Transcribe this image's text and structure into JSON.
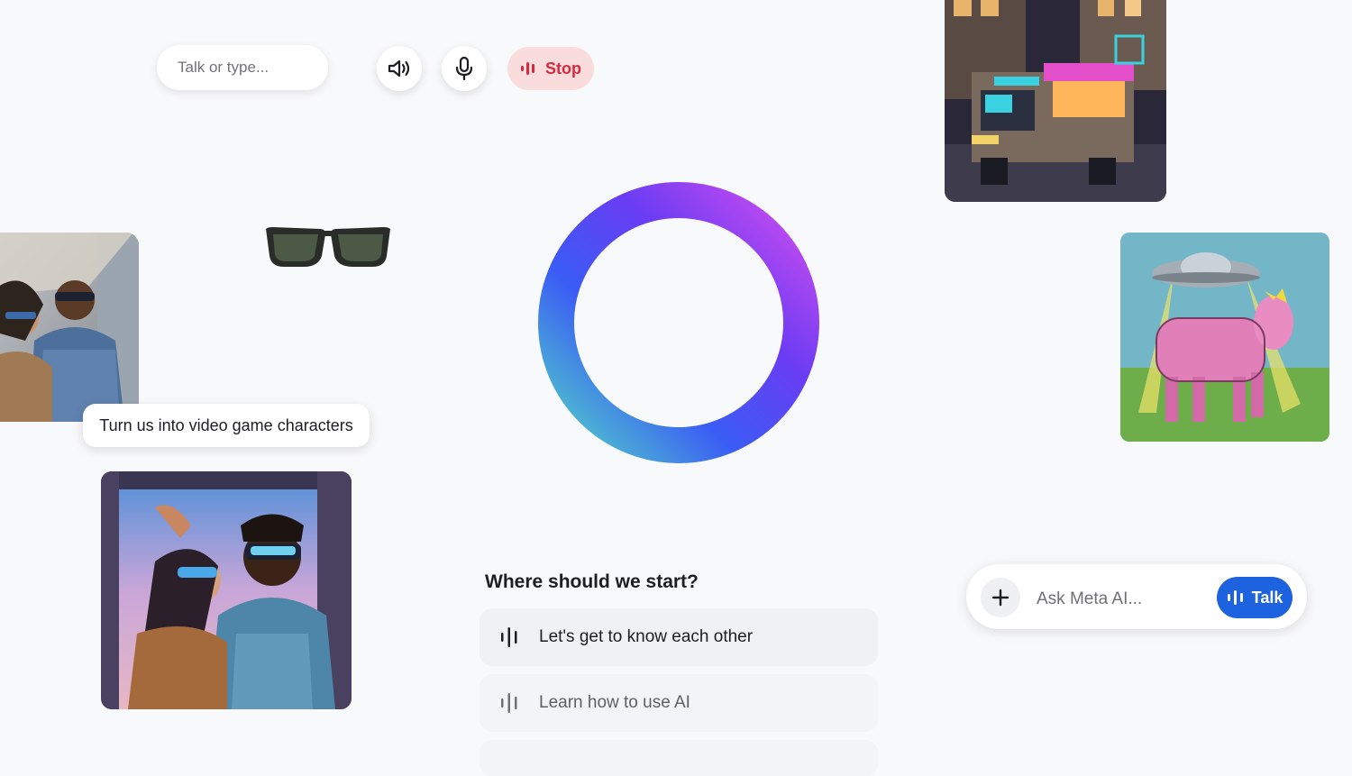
{
  "top_bar": {
    "talk_placeholder": "Talk or type...",
    "speaker_icon": "speaker-icon",
    "mic_icon": "microphone-icon",
    "stop_label": "Stop",
    "stop_color": "#d6293e"
  },
  "orb": {
    "gradient_colors": [
      "#c64cf0",
      "#6a3cf3",
      "#3a5cf5",
      "#4cc7cf"
    ]
  },
  "caption": {
    "text": "Turn us into video game characters"
  },
  "images": {
    "photo_couple": "couple-in-car-photo",
    "game_couple": "video-game-couple-illustration",
    "glasses": "sunglasses-image",
    "food_truck": "pixel-food-truck-image",
    "ufo_cow": "ufo-cow-illustration"
  },
  "prompts": {
    "title": "Where should we start?",
    "items": [
      {
        "label": "Let's get to know each other",
        "icon": "voice-wave-icon"
      },
      {
        "label": "Learn how to use AI",
        "icon": "voice-wave-icon"
      }
    ]
  },
  "ask_bar": {
    "placeholder": "Ask Meta AI...",
    "plus_icon": "plus-icon",
    "talk_label": "Talk",
    "accent": "#1d63e0"
  }
}
